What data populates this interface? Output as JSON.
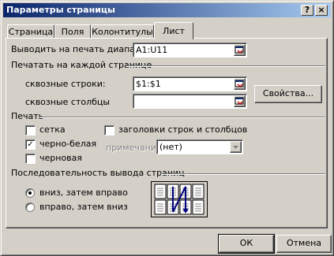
{
  "window": {
    "title": "Параметры страницы",
    "help_button": "?",
    "close_button": "×"
  },
  "tabs": [
    {
      "label": "Страница"
    },
    {
      "label": "Поля"
    },
    {
      "label": "Колонтитулы"
    },
    {
      "label": "Лист"
    }
  ],
  "print_area": {
    "label": "Выводить на печать диапазон:",
    "value": "A1:U11"
  },
  "print_titles": {
    "group_label": "Печатать на каждой странице",
    "rows_label": "сквозные строки:",
    "rows_value": "$1:$1",
    "columns_label": "сквозные столбцы",
    "columns_value": ""
  },
  "print": {
    "group_label": "Печать",
    "gridlines_label": "сетка",
    "gridlines_checked": false,
    "black_white_label": "черно-белая",
    "black_white_checked": true,
    "draft_label": "черновая",
    "draft_checked": false,
    "headings_label": "заголовки строк и столбцов",
    "headings_checked": false,
    "comments_label": "примечания:",
    "comments_value": "(нет)"
  },
  "page_order": {
    "group_label": "Последовательность вывода страниц",
    "down_then_over_label": "вниз, затем вправо",
    "over_then_down_label": "вправо, затем вниз",
    "selected": "down_then_over"
  },
  "buttons": {
    "properties": "Свойства...",
    "ok": "ОК",
    "cancel": "Отмена"
  },
  "icons": {
    "range_picker": "range-picker-icon",
    "dropdown": "chevron-down-icon",
    "page_order_preview": "page-order-preview-icon"
  },
  "colors": {
    "title_start": "#0a246a",
    "title_end": "#a6caf0",
    "face": "#d4d0c8"
  }
}
